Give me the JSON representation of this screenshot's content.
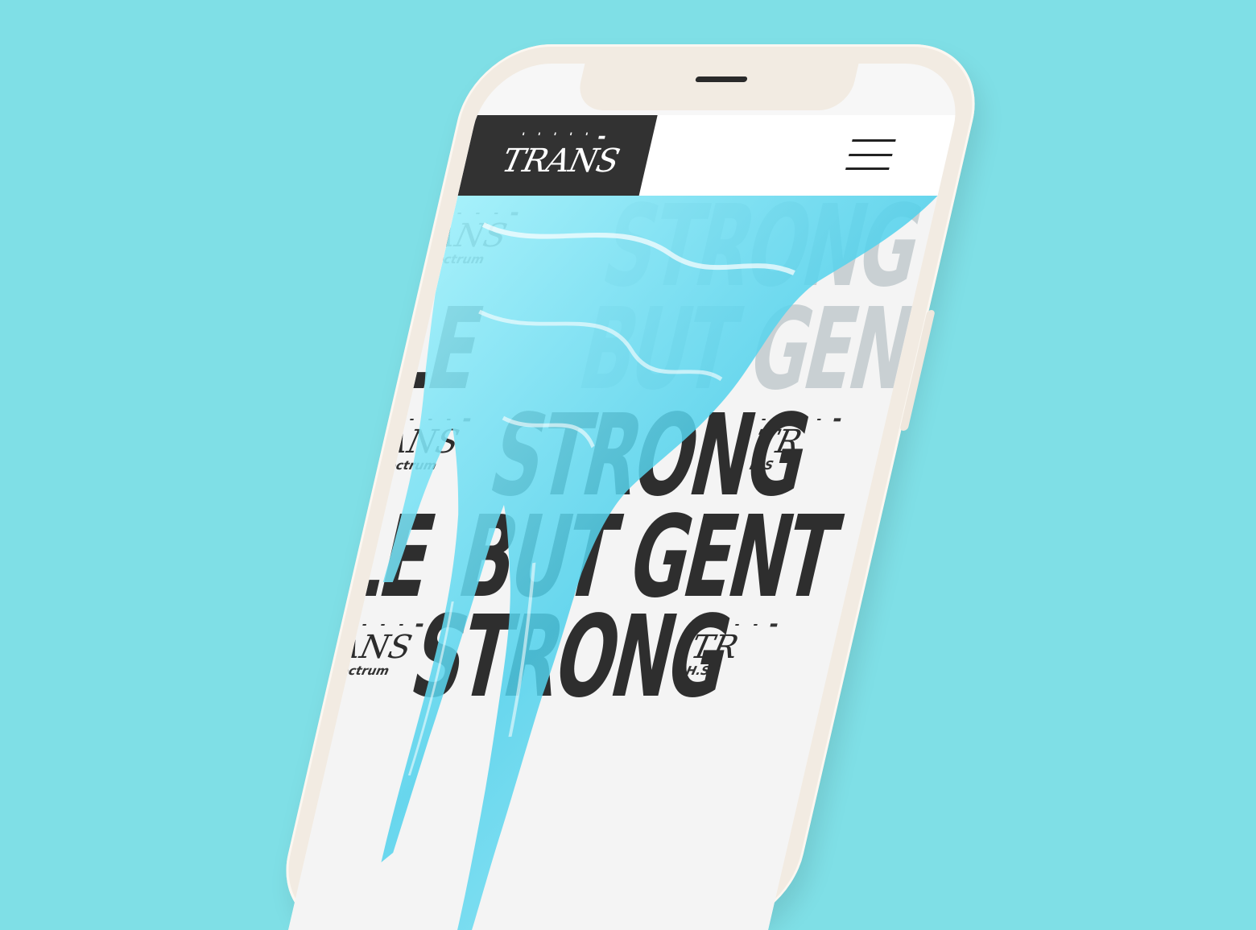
{
  "header": {
    "logo_dashes": "' ' ' ' ' ▬",
    "logo_text": "TRANS",
    "menu_icon": "hamburger-menu-icon"
  },
  "poster": {
    "dash_text": "- - - - ▬",
    "small_logo_left": "ANS",
    "small_logo_right": "TR",
    "spectrum_left": "pectrum",
    "spectrum_right": "H.S",
    "line_strong": "STRONG",
    "line_but_gent": "BUT GENT",
    "line_le": "LE",
    "ghost_strong": "STRONG",
    "ghost_but_gent": "BUT GENT"
  },
  "colors": {
    "background": "#7fdfe6",
    "phone_body": "#f2ebe2",
    "logo_bg": "#323232",
    "liquid_blue": "#5fd6ee"
  }
}
